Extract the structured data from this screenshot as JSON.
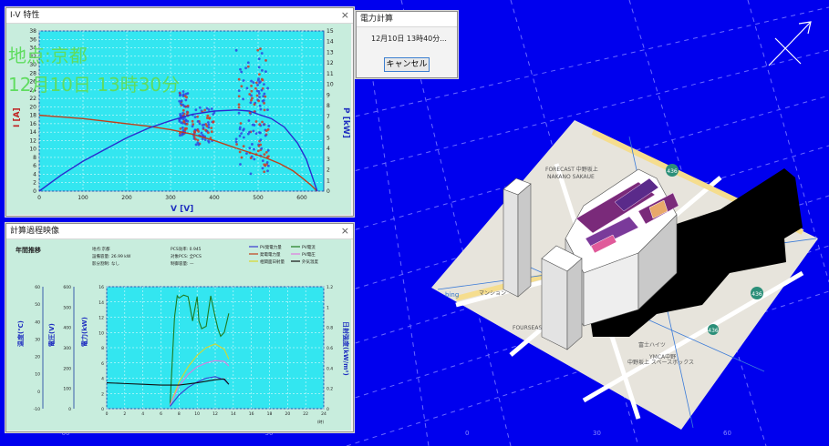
{
  "iv_window": {
    "title": "I-V 特性",
    "close": "×",
    "overlay_line1": "地点:京都",
    "overlay_line2": "12月10日  13時30分",
    "y_left_label": "I [A]",
    "y_right_label": "P [kW]",
    "x_label": "V [V]"
  },
  "calc_window": {
    "title": "計算過程映像",
    "close": "×",
    "heading": "年間推移",
    "info": {
      "location": "地点:京都",
      "capacity": "設備容量: 26.99 kW",
      "shading": "影分割制: なし",
      "pcs_eff": "PCS効率: 0.945",
      "target_pcs": "対象PCS: 全PCS",
      "control": "制御容量: —"
    },
    "legend": [
      "PV発電力量",
      "PV電流",
      "発電電力量",
      "PV電圧",
      "相関面日射量",
      "外気温度"
    ],
    "axis_labels": {
      "temp": "温度(℃)",
      "volt": "電圧(V)",
      "power": "電力(kW)",
      "irradiance": "日射強度(kW/m²)"
    },
    "x_unit": "(時)"
  },
  "dialog": {
    "title": "電力計算",
    "message": "12月10日  13時40分...",
    "cancel_label": "キャンセル"
  },
  "viewport": {
    "bottom_ticks": [
      "-60",
      "-30",
      "0",
      "30",
      "60"
    ],
    "map_badges": [
      "436",
      "436",
      "436"
    ],
    "map_labels": [
      "FORECAST 中野坂上",
      "NAKANO SAKAUE",
      "中野坂上 スペースボックス",
      "FOURSEASONS",
      "富士ハイツ",
      "YMCA中野",
      "マンション"
    ],
    "bing": "bing"
  },
  "chart_data": [
    {
      "type": "line",
      "title": "",
      "xlabel": "V [V]",
      "ylabel_left": "I [A]",
      "ylabel_right": "P [kW]",
      "xlim": [
        0,
        650
      ],
      "ylim_left": [
        0,
        38
      ],
      "ylim_right": [
        0,
        15
      ],
      "x_ticks": [
        0,
        100,
        200,
        300,
        400,
        500,
        600
      ],
      "y_left_ticks": [
        0,
        2,
        4,
        6,
        8,
        10,
        12,
        14,
        16,
        18,
        20,
        22,
        24,
        26,
        28,
        30,
        32,
        34,
        36,
        38
      ],
      "y_right_ticks": [
        0,
        1,
        2,
        3,
        4,
        5,
        6,
        7,
        8,
        9,
        10,
        11,
        12,
        13,
        14,
        15
      ],
      "grid": true,
      "series": [
        {
          "axis": "left",
          "color": "#c0401a",
          "x": [
            0,
            50,
            100,
            150,
            200,
            250,
            300,
            350,
            400,
            450,
            480,
            500,
            520,
            550,
            580,
            600,
            620,
            635
          ],
          "y": [
            18,
            17.6,
            17.2,
            16.6,
            16,
            15.4,
            14.6,
            13.5,
            12,
            10.2,
            9.2,
            8.5,
            7.8,
            6.5,
            4.8,
            3.2,
            1.5,
            0
          ]
        },
        {
          "axis": "right",
          "color": "#2a2ad0",
          "x": [
            0,
            50,
            100,
            150,
            200,
            250,
            300,
            350,
            400,
            450,
            480,
            500,
            530,
            560,
            590,
            610,
            625,
            635
          ],
          "y": [
            0,
            1.5,
            2.8,
            3.9,
            5.0,
            5.9,
            6.6,
            7.2,
            7.5,
            7.6,
            7.5,
            7.2,
            6.8,
            6.0,
            4.5,
            3.0,
            1.2,
            0
          ]
        }
      ]
    },
    {
      "type": "line",
      "title": "",
      "x_unit": "(時)",
      "xlim": [
        0,
        24
      ],
      "x_ticks": [
        0,
        2,
        4,
        6,
        8,
        10,
        12,
        14,
        16,
        18,
        20,
        22,
        24
      ],
      "ylim_power": [
        0,
        16
      ],
      "power_ticks": [
        0,
        2,
        4,
        6,
        8,
        10,
        12,
        14,
        16
      ],
      "temp_ticks": [
        -10,
        0,
        10,
        20,
        30,
        40,
        50,
        60
      ],
      "volt_ticks": [
        0,
        100,
        200,
        300,
        400,
        500,
        600
      ],
      "irr_ticks": [
        0.0,
        0.2,
        0.4,
        0.6,
        0.8,
        1.0,
        1.2
      ],
      "grid": true,
      "series": [
        {
          "name": "PV電流",
          "color": "#1e7a1e",
          "x": [
            7,
            7.5,
            7.8,
            8,
            8.5,
            9,
            9.5,
            10,
            10.2,
            10.5,
            11,
            11.5,
            12,
            12.3,
            12.6,
            13,
            13.5
          ],
          "y": [
            0.5,
            12,
            14.8,
            14.5,
            14.9,
            14.7,
            11.5,
            14.7,
            11.5,
            10.5,
            10.8,
            14.8,
            12,
            10.5,
            9.5,
            10,
            12.5
          ]
        },
        {
          "name": "相関面日射量",
          "color": "#d8d82a",
          "x": [
            7,
            8,
            9,
            10,
            11,
            12,
            13,
            13.5
          ],
          "y": [
            0.5,
            3.5,
            5.5,
            7.0,
            8.0,
            8.5,
            7.8,
            6.5
          ]
        },
        {
          "name": "PV電圧",
          "color": "#e07ae0",
          "x": [
            7,
            8,
            9,
            10,
            11,
            12,
            13,
            13.5
          ],
          "y": [
            0.5,
            3.0,
            4.5,
            5.5,
            6.0,
            6.3,
            6.2,
            5.6
          ]
        },
        {
          "name": "PV発電力量",
          "color": "#3a3ad0",
          "x": [
            7,
            8,
            9,
            10,
            11,
            12,
            13,
            13.5
          ],
          "y": [
            0.3,
            1.8,
            2.8,
            3.5,
            4.0,
            4.2,
            3.8,
            3.2
          ]
        },
        {
          "name": "外気温度",
          "color": "#111111",
          "x": [
            0,
            2,
            4,
            6,
            8,
            10,
            12,
            13,
            13.5
          ],
          "y": [
            3.4,
            3.3,
            3.2,
            3.1,
            3.1,
            3.4,
            3.8,
            3.9,
            3.2
          ]
        }
      ]
    }
  ]
}
